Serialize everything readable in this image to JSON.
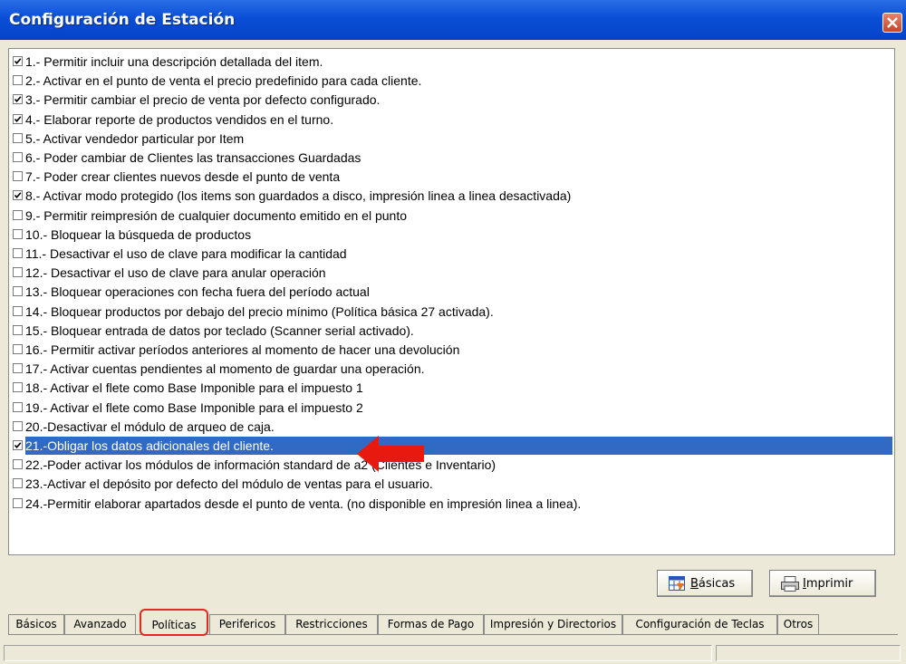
{
  "window": {
    "title": "Configuración de Estación"
  },
  "policies": [
    {
      "label": "1.- Permitir incluir una descripción detallada del item.",
      "checked": true
    },
    {
      "label": "2.- Activar en  el punto de venta el precio predefinido para cada cliente.",
      "checked": false
    },
    {
      "label": "3.- Permitir cambiar el precio de venta por defecto configurado.",
      "checked": true
    },
    {
      "label": "4.- Elaborar reporte de productos vendidos en el turno.",
      "checked": true
    },
    {
      "label": "5.- Activar vendedor particular por Item",
      "checked": false
    },
    {
      "label": "6.- Poder cambiar de Clientes las transacciones Guardadas",
      "checked": false
    },
    {
      "label": "7.- Poder crear clientes nuevos desde el punto de venta",
      "checked": false
    },
    {
      "label": "8.- Activar modo protegido (los items son guardados a disco, impresión linea a linea desactivada)",
      "checked": true
    },
    {
      "label": "9.- Permitir reimpresión de cualquier documento emitido en el punto",
      "checked": false
    },
    {
      "label": "10.- Bloquear la búsqueda de productos",
      "checked": false
    },
    {
      "label": "11.- Desactivar el uso de clave para modificar la cantidad",
      "checked": false
    },
    {
      "label": "12.- Desactivar el uso de clave para anular operación",
      "checked": false
    },
    {
      "label": "13.- Bloquear operaciones con fecha fuera del período actual",
      "checked": false
    },
    {
      "label": "14.- Bloquear productos por debajo del precio mínimo (Política básica 27 activada).",
      "checked": false
    },
    {
      "label": "15.- Bloquear entrada de datos por teclado (Scanner serial activado).",
      "checked": false
    },
    {
      "label": "16.- Permitir activar períodos anteriores al momento de hacer una devolución",
      "checked": false
    },
    {
      "label": "17.- Activar cuentas pendientes al momento de guardar una operación.",
      "checked": false
    },
    {
      "label": "18.- Activar el flete como Base Imponible para el impuesto 1",
      "checked": false
    },
    {
      "label": "19.- Activar el flete como Base Imponible para el impuesto 2",
      "checked": false
    },
    {
      "label": "20.-Desactivar el módulo de arqueo de caja.",
      "checked": false
    },
    {
      "label": "21.-Obligar los datos adicionales del cliente.",
      "checked": true,
      "selected": true
    },
    {
      "label": "22.-Poder activar los módulos de información standard de a2 (Clientes e Inventario)",
      "checked": false
    },
    {
      "label": "23.-Activar el depósito por defecto del módulo de ventas para el usuario.",
      "checked": false
    },
    {
      "label": "24.-Permitir elaborar apartados desde el punto de venta. (no disponible en impresión linea a linea).",
      "checked": false
    }
  ],
  "buttons": {
    "basicas": {
      "mnemonic": "B",
      "rest": "ásicas",
      "icon": "grid-icon"
    },
    "imprimir": {
      "mnemonic": "I",
      "rest": "mprimir",
      "icon": "printer-icon"
    }
  },
  "tabs": [
    {
      "label": "Básicos"
    },
    {
      "label": "Avanzado"
    },
    {
      "label": "Políticas",
      "active": true
    },
    {
      "label": "Perifericos"
    },
    {
      "label": "Restricciones"
    },
    {
      "label": "Formas de Pago"
    },
    {
      "label": "Impresión y Directorios"
    },
    {
      "label": "Configuración de Teclas"
    },
    {
      "label": "Otros"
    }
  ],
  "colors": {
    "selection": "#316ac5",
    "highlight": "#e02b20",
    "titlebar": "#0a4fd6"
  }
}
